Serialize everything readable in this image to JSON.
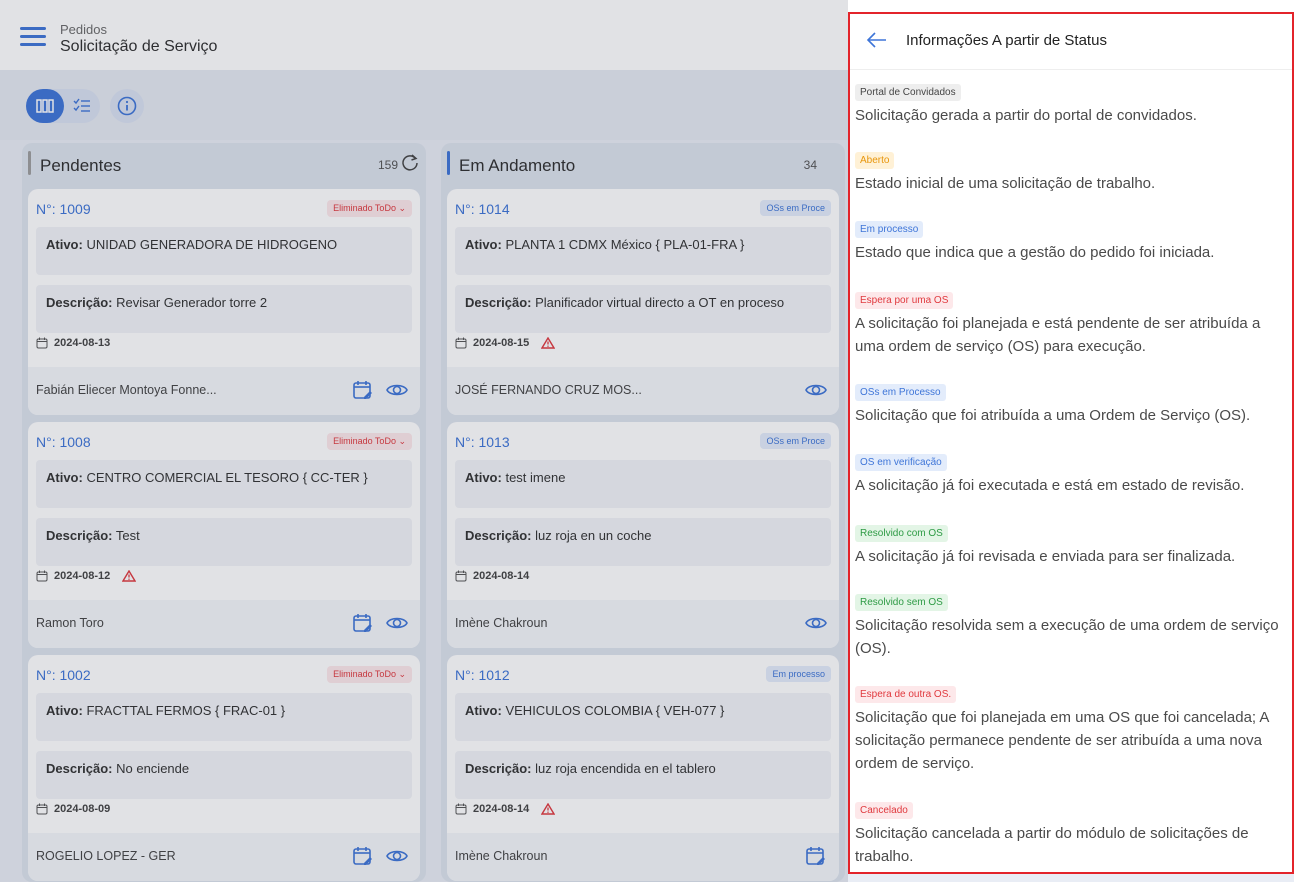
{
  "header": {
    "breadcrumb_parent": "Pedidos",
    "title": "Solicitação de Serviço"
  },
  "colors": {
    "accent": "#3e75d8",
    "danger": "#e0393e",
    "panel_border": "#e3242b"
  },
  "columns": [
    {
      "title": "Pendentes",
      "count": "159",
      "bar_color": "#9e9e9e",
      "cards": [
        {
          "id": "N°: 1009",
          "status": "Eliminado ToDo ⌄",
          "ativo_label": "Ativo:",
          "ativo": "UNIDAD GENERADORA DE HIDROGENO",
          "descricao_label": "Descrição:",
          "descricao": "Revisar Generador torre 2",
          "date": "2024-08-13",
          "warning": false,
          "user": "Fabián Eliecer Montoya Fonne..."
        },
        {
          "id": "N°: 1008",
          "status": "Eliminado ToDo ⌄",
          "ativo_label": "Ativo:",
          "ativo": "CENTRO COMERCIAL EL TESORO   { CC-TER }",
          "descricao_label": "Descrição:",
          "descricao": "Test",
          "date": "2024-08-12",
          "warning": true,
          "user": "Ramon Toro"
        },
        {
          "id": "N°: 1002",
          "status": "Eliminado ToDo ⌄",
          "ativo_label": "Ativo:",
          "ativo": "FRACTTAL FERMOS   { FRAC-01 }",
          "descricao_label": "Descrição:",
          "descricao": "No enciende",
          "date": "2024-08-09",
          "warning": false,
          "user": "ROGELIO LOPEZ - GER"
        }
      ]
    },
    {
      "title": "Em Andamento",
      "count": "34",
      "bar_color": "#3e75d8",
      "cards": [
        {
          "id": "N°: 1014",
          "status": "OSs em Proce",
          "ativo_label": "Ativo:",
          "ativo": "PLANTA 1 CDMX México { PLA-01-FRA }",
          "descricao_label": "Descrição:",
          "descricao": "Planificador virtual directo a OT en proceso",
          "date": "2024-08-15",
          "warning": true,
          "user": "JOSÉ FERNANDO CRUZ MOS..."
        },
        {
          "id": "N°: 1013",
          "status": "OSs em Proce",
          "ativo_label": "Ativo:",
          "ativo": "test imene",
          "descricao_label": "Descrição:",
          "descricao": "luz roja en un coche",
          "date": "2024-08-14",
          "warning": false,
          "user": "Imène Chakroun"
        },
        {
          "id": "N°: 1012",
          "status": "Em processo",
          "ativo_label": "Ativo:",
          "ativo": "VEHICULOS  COLOMBIA { VEH-077 }",
          "descricao_label": "Descrição:",
          "descricao": "luz roja encendida en el tablero",
          "date": "2024-08-14",
          "warning": true,
          "user": "Imène Chakroun"
        }
      ]
    }
  ],
  "panel": {
    "title": "Informações A partir de Status",
    "statuses": [
      {
        "label": "Portal de Convidados",
        "fg": "#444444",
        "bg": "#eeeeee",
        "description": "Solicitação gerada a partir do portal de convidados."
      },
      {
        "label": "Aberto",
        "fg": "#e8960c",
        "bg": "#fff1d6",
        "description": "Estado inicial de uma solicitação de trabalho."
      },
      {
        "label": "Em processo",
        "fg": "#3e75d8",
        "bg": "#e3ecfb",
        "description": "Estado que indica que a gestão do pedido foi iniciada."
      },
      {
        "label": "Espera por uma OS",
        "fg": "#e0393e",
        "bg": "#fde8ea",
        "description": "A solicitação foi planejada e está pendente de ser atribuída a uma ordem de serviço (OS) para execução."
      },
      {
        "label": "OSs em Processo",
        "fg": "#3e75d8",
        "bg": "#e3ecfb",
        "description": "Solicitação que foi atribuída a uma Ordem de Serviço (OS)."
      },
      {
        "label": "OS em verificação",
        "fg": "#3e75d8",
        "bg": "#e3ecfb",
        "description": "A solicitação já foi executada e está em estado de revisão."
      },
      {
        "label": "Resolvido com OS",
        "fg": "#2e9b45",
        "bg": "#e3f5e6",
        "description": "A solicitação já foi revisada e enviada para ser finalizada."
      },
      {
        "label": "Resolvido sem OS",
        "fg": "#2e9b45",
        "bg": "#e3f5e6",
        "description": "Solicitação resolvida sem a execução de uma ordem de serviço (OS)."
      },
      {
        "label": "Espera de outra OS.",
        "fg": "#e0393e",
        "bg": "#fde8ea",
        "description": "Solicitação que foi planejada em uma OS que foi cancelada; A solicitação permanece pendente de ser atribuída a uma nova ordem de serviço."
      },
      {
        "label": "Cancelado",
        "fg": "#e0393e",
        "bg": "#fde8ea",
        "description": "Solicitação cancelada a partir do módulo de solicitações de trabalho."
      }
    ]
  }
}
